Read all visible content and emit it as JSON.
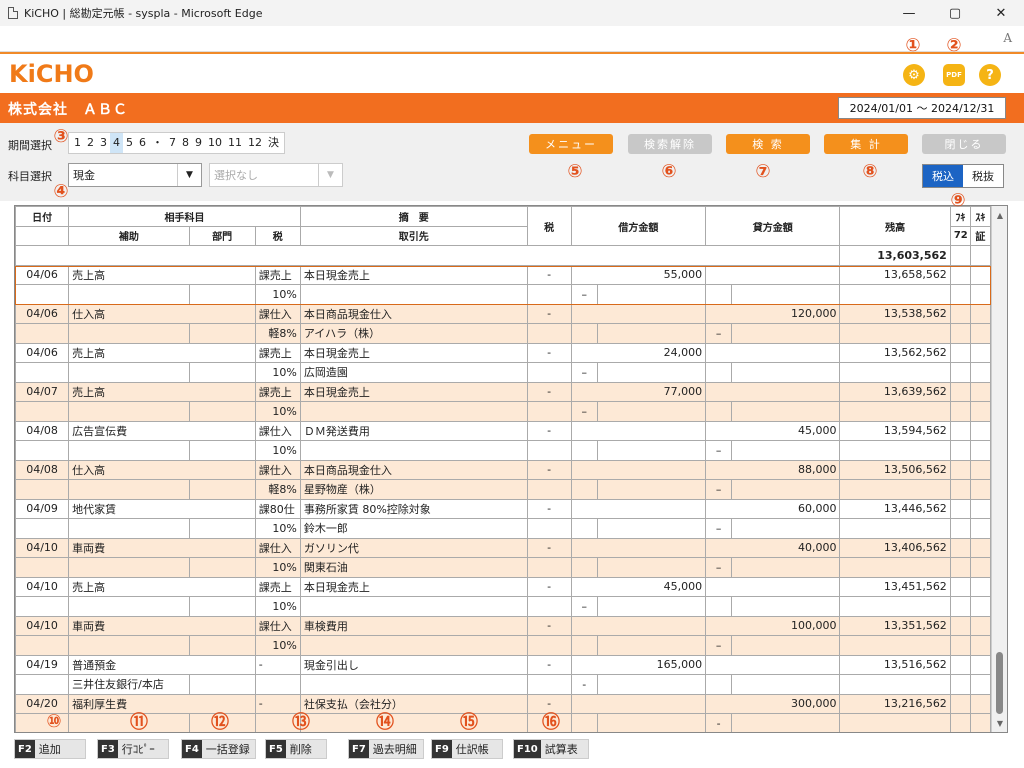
{
  "window": {
    "title": "KiCHO | 総勘定元帳 - syspla - Microsoft Edge",
    "minimize": "—",
    "maximize": "▢",
    "close": "✕",
    "read_aloud": "A"
  },
  "app": {
    "logo": "KiCHO",
    "settings_glyph": "⚙",
    "pdf_glyph": "PDF",
    "help_glyph": "?"
  },
  "company": {
    "name": "株式会社　ＡＢＣ",
    "period": "2024/01/01 ～ 2024/12/31"
  },
  "filters": {
    "period_label": "期間選択",
    "months": [
      "1",
      "2",
      "3",
      "4",
      "5",
      "6",
      "・",
      "7",
      "8",
      "9",
      "10",
      "11",
      "12",
      "決"
    ],
    "selected_month": "4",
    "account_label": "科目選択",
    "account_value": "現金",
    "sub_account_value": "選択なし",
    "dropdown_glyph": "▼"
  },
  "buttons": {
    "menu": "メニュー",
    "search_clear": "検索解除",
    "search": "検 索",
    "aggregate": "集 計",
    "close": "閉じる",
    "tax_incl": "税込",
    "tax_excl": "税抜"
  },
  "callouts": [
    "①",
    "②",
    "③",
    "④",
    "⑤",
    "⑥",
    "⑦",
    "⑧",
    "⑨",
    "⑩",
    "⑪",
    "⑫",
    "⑬",
    "⑭",
    "⑮",
    "⑯"
  ],
  "grid": {
    "headers": {
      "date": "日付",
      "counter_account": "相手科目",
      "sub": "補助",
      "dept": "部門",
      "tax": "税",
      "summary": "摘　要",
      "client": "取引先",
      "tax2": "税",
      "debit": "借方金額",
      "credit": "貸方金額",
      "balance": "残高",
      "col_fu": "ﾌｷ",
      "col_72": "72",
      "col_shou": "ｽｷ",
      "col_evid": "証"
    },
    "opening_balance": "13,603,562",
    "rows": [
      {
        "date": "04/06",
        "account": "売上高",
        "sub": "",
        "dept": "",
        "tax1": "課売上",
        "tax2": "10%",
        "summary": "本日現金売上",
        "client": "",
        "taxmark": "-",
        "debit": "55,000",
        "debit_mark": "–",
        "credit": "",
        "credit_mark": "",
        "balance": "13,658,562"
      },
      {
        "date": "04/06",
        "account": "仕入高",
        "sub": "",
        "dept": "",
        "tax1": "課仕入",
        "tax2": "軽8%",
        "summary": "本日商品現金仕入",
        "client": "アイハラ（株）",
        "taxmark": "-",
        "debit": "",
        "debit_mark": "",
        "credit": "120,000",
        "credit_mark": "–",
        "balance": "13,538,562"
      },
      {
        "date": "04/06",
        "account": "売上高",
        "sub": "",
        "dept": "",
        "tax1": "課売上",
        "tax2": "10%",
        "summary": "本日現金売上",
        "client": "広岡造園",
        "taxmark": "-",
        "debit": "24,000",
        "debit_mark": "–",
        "credit": "",
        "credit_mark": "",
        "balance": "13,562,562"
      },
      {
        "date": "04/07",
        "account": "売上高",
        "sub": "",
        "dept": "",
        "tax1": "課売上",
        "tax2": "10%",
        "summary": "本日現金売上",
        "client": "",
        "taxmark": "-",
        "debit": "77,000",
        "debit_mark": "–",
        "credit": "",
        "credit_mark": "",
        "balance": "13,639,562"
      },
      {
        "date": "04/08",
        "account": "広告宣伝費",
        "sub": "",
        "dept": "",
        "tax1": "課仕入",
        "tax2": "10%",
        "summary": "ＤＭ発送費用",
        "client": "",
        "taxmark": "-",
        "debit": "",
        "debit_mark": "",
        "credit": "45,000",
        "credit_mark": "–",
        "balance": "13,594,562"
      },
      {
        "date": "04/08",
        "account": "仕入高",
        "sub": "",
        "dept": "",
        "tax1": "課仕入",
        "tax2": "軽8%",
        "summary": "本日商品現金仕入",
        "client": "星野物産（株）",
        "taxmark": "-",
        "debit": "",
        "debit_mark": "",
        "credit": "88,000",
        "credit_mark": "–",
        "balance": "13,506,562"
      },
      {
        "date": "04/09",
        "account": "地代家賃",
        "sub": "",
        "dept": "",
        "tax1": "課80仕",
        "tax2": "10%",
        "summary": "事務所家賃 80%控除対象",
        "client": "鈴木一郎",
        "taxmark": "-",
        "debit": "",
        "debit_mark": "",
        "credit": "60,000",
        "credit_mark": "–",
        "balance": "13,446,562"
      },
      {
        "date": "04/10",
        "account": "車両費",
        "sub": "",
        "dept": "",
        "tax1": "課仕入",
        "tax2": "10%",
        "summary": "ガソリン代",
        "client": "関東石油",
        "taxmark": "-",
        "debit": "",
        "debit_mark": "",
        "credit": "40,000",
        "credit_mark": "–",
        "balance": "13,406,562"
      },
      {
        "date": "04/10",
        "account": "売上高",
        "sub": "",
        "dept": "",
        "tax1": "課売上",
        "tax2": "10%",
        "summary": "本日現金売上",
        "client": "",
        "taxmark": "-",
        "debit": "45,000",
        "debit_mark": "–",
        "credit": "",
        "credit_mark": "",
        "balance": "13,451,562"
      },
      {
        "date": "04/10",
        "account": "車両費",
        "sub": "",
        "dept": "",
        "tax1": "課仕入",
        "tax2": "10%",
        "summary": "車検費用",
        "client": "",
        "taxmark": "-",
        "debit": "",
        "debit_mark": "",
        "credit": "100,000",
        "credit_mark": "–",
        "balance": "13,351,562"
      },
      {
        "date": "04/19",
        "account": "普通預金",
        "sub": "三井住友銀行/本店",
        "dept": "",
        "tax1": "-",
        "tax2": "",
        "summary": "現金引出し",
        "client": "",
        "taxmark": "-",
        "debit": "165,000",
        "debit_mark": "-",
        "credit": "",
        "credit_mark": "",
        "balance": "13,516,562"
      },
      {
        "date": "04/20",
        "account": "福利厚生費",
        "sub": "",
        "dept": "",
        "tax1": "-",
        "tax2": "",
        "summary": "社保支払（会社分）",
        "client": "",
        "taxmark": "-",
        "debit": "",
        "debit_mark": "",
        "credit": "300,000",
        "credit_mark": "-",
        "balance": "13,216,562"
      }
    ]
  },
  "fkeys": [
    {
      "key": "F2",
      "label": "追加"
    },
    {
      "key": "F3",
      "label": "行ｺﾋﾟｰ"
    },
    {
      "key": "F4",
      "label": "一括登録"
    },
    {
      "key": "F5",
      "label": "削除"
    },
    {
      "key": "F7",
      "label": "過去明細"
    },
    {
      "key": "F9",
      "label": "仕訳帳"
    },
    {
      "key": "F10",
      "label": "試算表"
    }
  ]
}
